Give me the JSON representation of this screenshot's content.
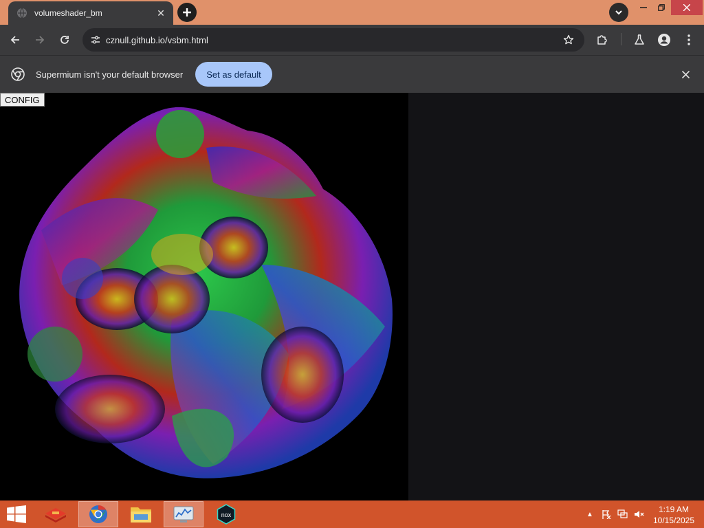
{
  "tab": {
    "title": "volumeshader_bm"
  },
  "address_bar": {
    "url": "cznull.github.io/vsbm.html"
  },
  "infobar": {
    "message": "Supermium isn't your default browser",
    "button_label": "Set as default"
  },
  "page": {
    "config_button_label": "CONFIG"
  },
  "taskbar": {
    "apps": [
      "stack-app-icon",
      "supermium-browser-icon",
      "file-explorer-icon",
      "resource-monitor-icon",
      "nox-player-icon"
    ],
    "clock": {
      "time": "1:19 AM",
      "date": "10/15/2025"
    }
  },
  "colors": {
    "titlebar": "#e0916a",
    "toolbar": "#3a3a3c",
    "accent_button": "#a8c7fa",
    "taskbar": "#d1542b",
    "page_background": "#131316",
    "canvas_background": "#000000"
  }
}
